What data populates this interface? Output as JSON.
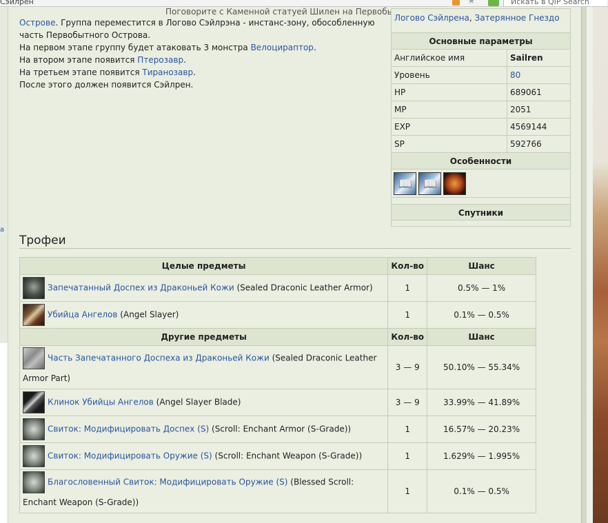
{
  "browser": {
    "address_fragment": "Сэйлрен",
    "search_placeholder": "Искать в QIP Search"
  },
  "sidebar_fragment": "а",
  "intro": {
    "clipped_line": "Поговорите с Каменной статуей Шилен на Первобытном",
    "line1_link": "Острове",
    "line1_rest": ". Группа переместится в Логово Сэйлрэна - инстанс-зону, обособленную часть Первобытного Острова.",
    "line2_text": "На первом этапе группу будет атаковать 3 монстра ",
    "line2_link": "Велоцираптор",
    "line2_end": ".",
    "line3_text": "На втором этапе появится ",
    "line3_link": "Птерозавр",
    "line3_end": ".",
    "line4_text": "На третьем этапе появится ",
    "line4_link": "Тиранозавр",
    "line4_end": ".",
    "line5_text": "После этого должен появится Сэйлрен."
  },
  "infobox": {
    "location_link1": "Логово Сэйлрена",
    "location_sep": ", ",
    "location_link2": "Затерянное Гнездо",
    "main_header": "Основные параметры",
    "rows": [
      {
        "key": "Английское имя",
        "value": "Sailren"
      },
      {
        "key": "Уровень",
        "value": "80"
      },
      {
        "key": "HP",
        "value": "689061"
      },
      {
        "key": "MP",
        "value": "2051"
      },
      {
        "key": "EXP",
        "value": "4569144"
      },
      {
        "key": "SP",
        "value": "592766"
      }
    ],
    "features_header": "Особенности",
    "feature_icons": [
      "book-skill-icon",
      "book-skill-icon",
      "raid-boss-face-icon"
    ],
    "companions_header": "Спутники"
  },
  "trophies": {
    "heading": "Трофеи",
    "whole_header": "Целые предметы",
    "other_header": "Другие предметы",
    "qty_header": "Кол-во",
    "chance_header": "Шанс",
    "whole_items": [
      {
        "link": "Запечатанный Доспех из Драконьей Кожи",
        "en": " (Sealed Draconic Leather Armor)",
        "qty": "1",
        "chance": "0.5% — 1%"
      },
      {
        "link": "Убийца Ангелов",
        "en": " (Angel Slayer)",
        "qty": "1",
        "chance": "0.1% — 0.5%"
      }
    ],
    "other_items": [
      {
        "link": "Часть Запечатанного Доспеха из Драконьей Кожи",
        "en": " (Sealed Draconic Leather Armor Part)",
        "qty": "3 — 9",
        "chance": "50.10% — 55.34%"
      },
      {
        "link": "Клинок Убийцы Ангелов",
        "en": " (Angel Slayer Blade)",
        "qty": "3 — 9",
        "chance": "33.99% — 41.89%"
      },
      {
        "link": "Свиток: Модифицировать Доспех (S)",
        "en": " (Scroll: Enchant Armor (S-Grade))",
        "qty": "1",
        "chance": "16.57% — 20.23%"
      },
      {
        "link": "Свиток: Модифицировать Оружие (S)",
        "en": " (Scroll: Enchant Weapon (S-Grade))",
        "qty": "1",
        "chance": "1.629% — 1.995%"
      },
      {
        "link": "Благословенный Свиток: Модифицировать Оружие (S)",
        "en": " (Blessed Scroll: Enchant Weapon (S-Grade))",
        "qty": "1",
        "chance": "0.1% — 0.5%"
      }
    ]
  }
}
